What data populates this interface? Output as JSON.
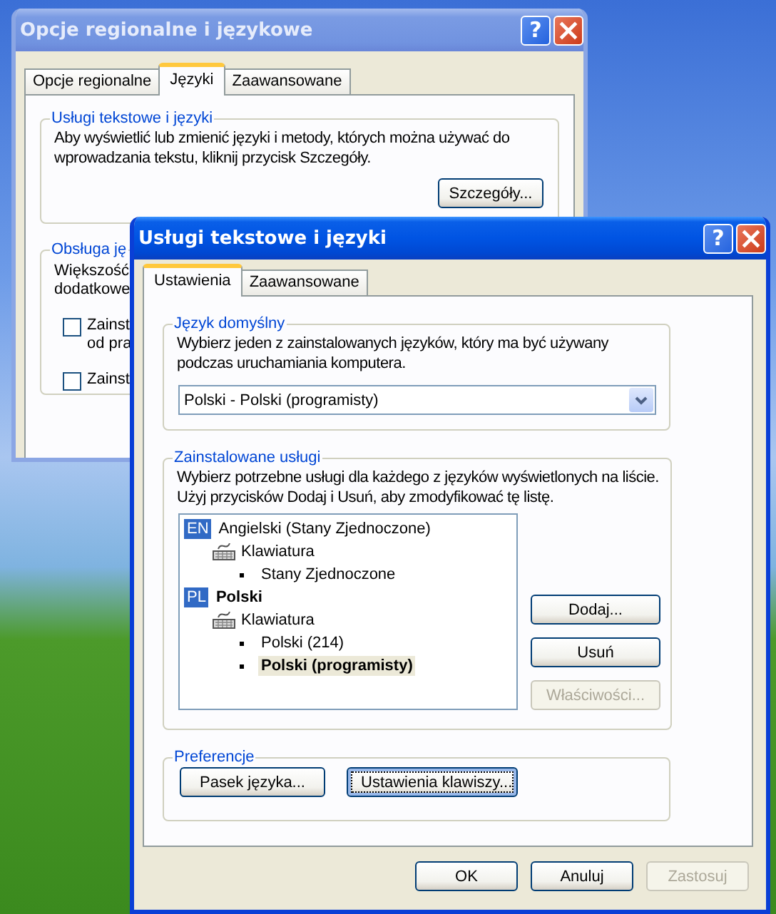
{
  "background_window": {
    "title": "Opcje regionalne i językowe",
    "help_button": "?",
    "active": false,
    "tabs": [
      {
        "label": "Opcje regionalne",
        "selected": false
      },
      {
        "label": "Języki",
        "selected": true
      },
      {
        "label": "Zaawansowane",
        "selected": false
      }
    ],
    "text_services_group": {
      "title": "Usługi tekstowe i języki",
      "description": "Aby wyświetlić lub zmienić języki i metody, których można używać do wprowadzania tekstu, kliknij przycisk Szczegóły.",
      "button": "Szczegóły..."
    },
    "support_group": {
      "title": "Obsługa ję",
      "lines": [
        "Większość",
        "dodatkowe"
      ],
      "checkboxes": [
        {
          "label_lines": [
            "Zainst",
            "od pra"
          ],
          "checked": false
        },
        {
          "label_lines": [
            "Zainst"
          ],
          "checked": false
        }
      ]
    }
  },
  "dialog": {
    "title": "Usługi tekstowe i języki",
    "help_button": "?",
    "active": true,
    "tabs": [
      {
        "label": "Ustawienia",
        "selected": true
      },
      {
        "label": "Zaawansowane",
        "selected": false
      }
    ],
    "default_language": {
      "title": "Język domyślny",
      "description": "Wybierz jeden z zainstalowanych języków, który ma być używany podczas uruchamiania komputera.",
      "dropdown": {
        "value": "Polski - Polski (programisty)"
      }
    },
    "installed_services": {
      "title": "Zainstalowane usługi",
      "description": "Wybierz potrzebne usługi dla każdego z języków wyświetlonych na liście. Użyj przycisków Dodaj i Usuń, aby zmodyfikować tę listę.",
      "tree": [
        {
          "kind": "language",
          "badge": "EN",
          "label": "Angielski (Stany Zjednoczone)",
          "default": false,
          "children": [
            {
              "kind": "category",
              "label": "Klawiatura",
              "children": [
                {
                  "kind": "layout",
                  "label": "Stany Zjednoczone",
                  "default": false,
                  "selected": false
                }
              ]
            }
          ]
        },
        {
          "kind": "language",
          "badge": "PL",
          "label": "Polski",
          "default": true,
          "children": [
            {
              "kind": "category",
              "label": "Klawiatura",
              "children": [
                {
                  "kind": "layout",
                  "label": "Polski (214)",
                  "default": false,
                  "selected": false
                },
                {
                  "kind": "layout",
                  "label": "Polski (programisty)",
                  "default": true,
                  "selected": true
                }
              ]
            }
          ]
        }
      ],
      "buttons": [
        {
          "label": "Dodaj...",
          "disabled": false
        },
        {
          "label": "Usuń",
          "disabled": false
        },
        {
          "label": "Właściwości...",
          "disabled": true
        }
      ]
    },
    "preferences": {
      "title": "Preferencje",
      "buttons": [
        {
          "label": "Pasek języka...",
          "focused": false
        },
        {
          "label": "Ustawienia klawiszy...",
          "focused": true
        }
      ]
    },
    "buttons": [
      {
        "label": "OK",
        "disabled": false
      },
      {
        "label": "Anuluj",
        "disabled": false
      },
      {
        "label": "Zastosuj",
        "disabled": true
      }
    ]
  }
}
